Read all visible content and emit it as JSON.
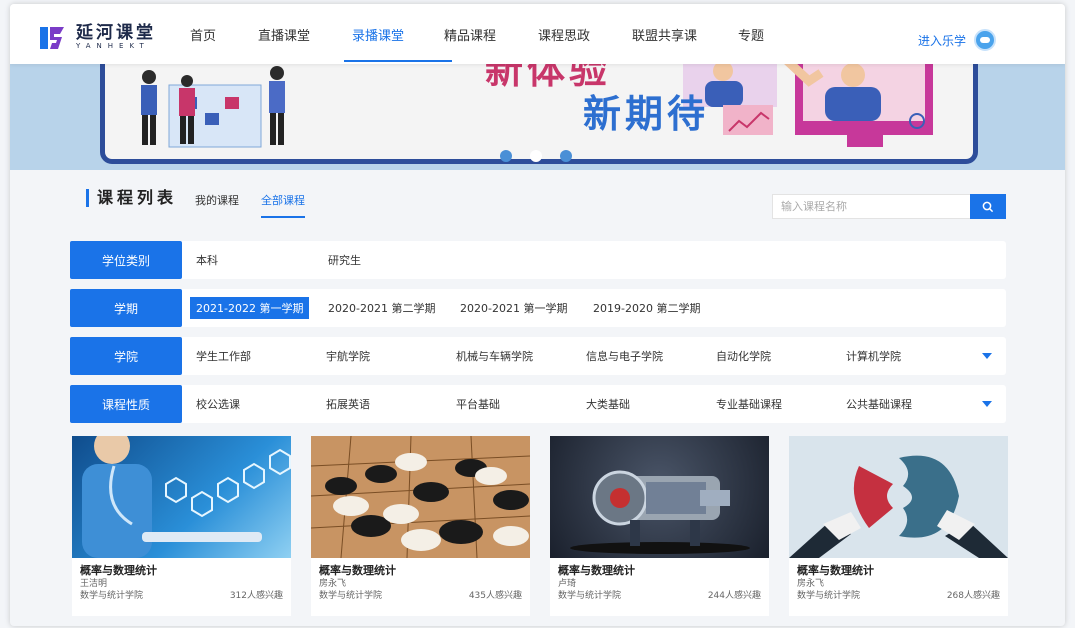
{
  "brand": {
    "name_cn": "延河课堂",
    "name_en": "YANHEKT",
    "accent": "#1a73e8"
  },
  "nav": {
    "items": [
      {
        "label": "首页",
        "active": false
      },
      {
        "label": "直播课堂",
        "active": false
      },
      {
        "label": "录播课堂",
        "active": true
      },
      {
        "label": "精品课程",
        "active": false
      },
      {
        "label": "课程思政",
        "active": false
      },
      {
        "label": "联盟共享课",
        "active": false
      },
      {
        "label": "专题",
        "active": false
      }
    ],
    "enter_label": "进入乐学"
  },
  "banner": {
    "line1": "新体验",
    "line2": "新期待",
    "slides": 3,
    "active_slide": 1
  },
  "course_list": {
    "title": "课程列表",
    "tabs": [
      {
        "label": "我的课程",
        "active": false
      },
      {
        "label": "全部课程",
        "active": true
      }
    ],
    "search_placeholder": "输入课程名称"
  },
  "filters": [
    {
      "label": "学位类别",
      "options": [
        "本科",
        "研究生"
      ],
      "selected": -1,
      "expandable": false
    },
    {
      "label": "学期",
      "options": [
        "2021-2022 第一学期",
        "2020-2021 第二学期",
        "2020-2021 第一学期",
        "2019-2020 第二学期"
      ],
      "selected": 0,
      "expandable": false
    },
    {
      "label": "学院",
      "options": [
        "学生工作部",
        "宇航学院",
        "机械与车辆学院",
        "信息与电子学院",
        "自动化学院",
        "计算机学院"
      ],
      "selected": -1,
      "expandable": true
    },
    {
      "label": "课程性质",
      "options": [
        "校公选课",
        "拓展英语",
        "平台基础",
        "大类基础",
        "专业基础课程",
        "公共基础课程"
      ],
      "selected": -1,
      "expandable": true
    }
  ],
  "courses": [
    {
      "title": "概率与数理统计",
      "teacher": "王洁明",
      "college": "数学与统计学院",
      "interest": "312人感兴趣",
      "image": "medical-tech"
    },
    {
      "title": "概率与数理统计",
      "teacher": "房永飞",
      "college": "数学与统计学院",
      "interest": "435人感兴趣",
      "image": "go-game"
    },
    {
      "title": "概率与数理统计",
      "teacher": "卢琦",
      "college": "数学与统计学院",
      "interest": "244人感兴趣",
      "image": "engine"
    },
    {
      "title": "概率与数理统计",
      "teacher": "房永飞",
      "college": "数学与统计学院",
      "interest": "268人感兴趣",
      "image": "puzzle"
    }
  ]
}
